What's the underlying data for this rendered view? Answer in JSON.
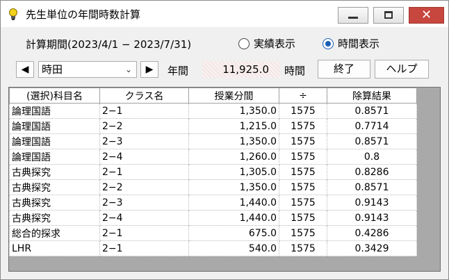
{
  "window": {
    "title": "先生単位の年間時数計算"
  },
  "header": {
    "period_label": "計算期間(2023/4/1 − 2023/7/31)",
    "radio_jisseki": "実績表示",
    "radio_jikan": "時間表示",
    "selected_radio": "時間表示"
  },
  "toolbar": {
    "teacher": "時田",
    "nenkan_label": "年間",
    "total_value": "11,925.0",
    "jikan_label": "時間",
    "exit_label": "終了",
    "help_label": "ヘルプ"
  },
  "table": {
    "columns": [
      "(選択)科目名",
      "クラス名",
      "授業分間",
      "÷",
      "除算結果"
    ],
    "rows": [
      [
        "論理国語",
        "2−1",
        "1,350.0",
        "1575",
        "0.8571"
      ],
      [
        "論理国語",
        "2−2",
        "1,215.0",
        "1575",
        "0.7714"
      ],
      [
        "論理国語",
        "2−3",
        "1,350.0",
        "1575",
        "0.8571"
      ],
      [
        "論理国語",
        "2−4",
        "1,260.0",
        "1575",
        "0.8"
      ],
      [
        "古典探究",
        "2−1",
        "1,305.0",
        "1575",
        "0.8286"
      ],
      [
        "古典探究",
        "2−2",
        "1,350.0",
        "1575",
        "0.8571"
      ],
      [
        "古典探究",
        "2−3",
        "1,440.0",
        "1575",
        "0.9143"
      ],
      [
        "古典探究",
        "2−4",
        "1,440.0",
        "1575",
        "0.9143"
      ],
      [
        "総合的探求",
        "2−1",
        "675.0",
        "1575",
        "0.4286"
      ],
      [
        "LHR",
        "2−1",
        "540.0",
        "1575",
        "0.3429"
      ]
    ]
  }
}
